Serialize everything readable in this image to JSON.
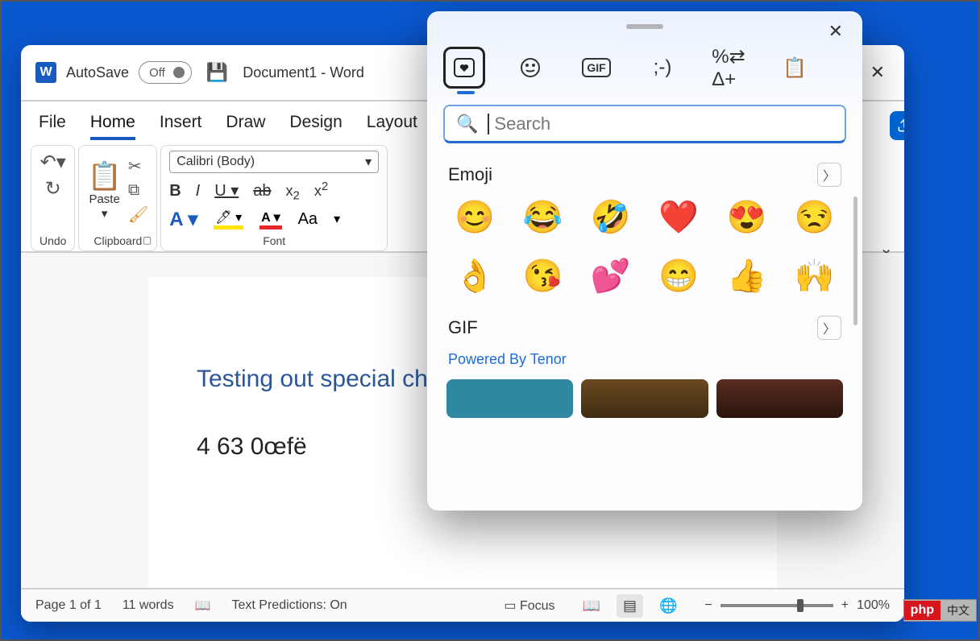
{
  "titlebar": {
    "autosave_label": "AutoSave",
    "autosave_state": "Off",
    "doc_title": "Document1  -  Word"
  },
  "share": {
    "icon": "share"
  },
  "menu": {
    "items": [
      "File",
      "Home",
      "Insert",
      "Draw",
      "Design",
      "Layout"
    ],
    "active": "Home"
  },
  "ribbon": {
    "undo_label": "Undo",
    "clipboard_label": "Clipboard",
    "paste_label": "Paste",
    "font_label": "Font",
    "font_family": "Calibri (Body)",
    "case_button": "Aa"
  },
  "document": {
    "heading": "Testing out special characters in",
    "body": "4 63   0œfë"
  },
  "status": {
    "page": "Page 1 of 1",
    "words": "11 words",
    "predictions": "Text Predictions: On",
    "focus": "Focus",
    "zoom": "100%"
  },
  "emoji_panel": {
    "search_placeholder": "Search",
    "sections": {
      "emoji_title": "Emoji",
      "gif_title": "GIF",
      "gif_powered": "Powered By Tenor"
    },
    "emojis": [
      "😊",
      "😂",
      "🤣",
      "❤️",
      "😍",
      "😒",
      "👌",
      "😘",
      "💕",
      "😁",
      "👍",
      "🙌"
    ]
  },
  "footer_badge": {
    "brand": "php",
    "tag": "中文"
  }
}
